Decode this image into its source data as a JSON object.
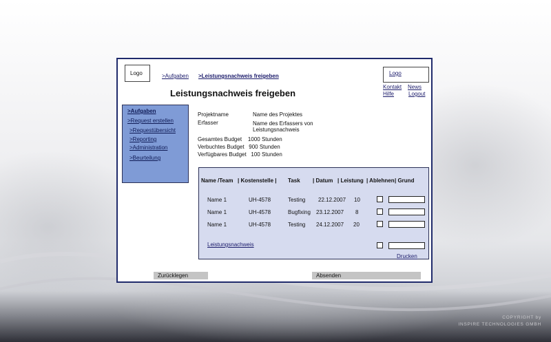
{
  "header": {
    "logo_left": "Logo",
    "breadcrumb_1": ">Aufgaben",
    "breadcrumb_2": ">Leistungsnachweis freigeben",
    "logo_right": "Logo",
    "kontakt": "Kontakt",
    "news": "News",
    "hilfe": "Hilfe",
    "logout": "Logout",
    "page_title": "Leistungsnachweis freigeben"
  },
  "sidebar": {
    "items": [
      ">Aufgaben",
      ">Request erstellen",
      ">Requestübersicht",
      ">Reporting",
      ">Administration",
      ">Beurteilung"
    ]
  },
  "info": {
    "projektname_label": "Projektname",
    "projektname_value": "Name des Projektes",
    "erfasser_label": "Erfasser",
    "erfasser_value_1": "Name des Erfassers von",
    "erfasser_value_2": "Leistungsnachweis",
    "gesamt": "Gesamtes Budget    1000 Stunden",
    "verbraucht": "Verbuchtes Budget   900 Stunden",
    "verfuegbar": "Verfügbares Budget   100 Stunden"
  },
  "table": {
    "headers": [
      "Name /Team",
      "| Kostenstelle |",
      "Task",
      "| Datum",
      "| Leistung",
      "| Ablehnen",
      "| Grund"
    ],
    "rows": [
      {
        "name": "Name 1",
        "kostenstelle": "UH-4578",
        "task": "Testing",
        "datum": "22.12.2007",
        "leistung": "10"
      },
      {
        "name": "Name 1",
        "kostenstelle": "UH-4578",
        "task": "Bugfixing",
        "datum": "23.12.2007",
        "leistung": "8"
      },
      {
        "name": "Name 1",
        "kostenstelle": "UH-4578",
        "task": "Testing",
        "datum": "24.12.2007",
        "leistung": "20"
      }
    ],
    "leistungsnachweis_link": "Leistungsnachweis",
    "drucken_link": "Drucken"
  },
  "buttons": {
    "zuruecklegen": "Zurücklegen",
    "absenden": "Absenden"
  },
  "footer": {
    "copyright_1": "COPYRIGHT by",
    "copyright_2": "INSPIRE TECHNOLOGIES GMBH"
  },
  "colors": {
    "frame_border": "#1f2a6b",
    "sidebar_bg": "#7f9bd6",
    "table_bg": "#d6dbef",
    "button_bg": "#c4c4c4"
  }
}
